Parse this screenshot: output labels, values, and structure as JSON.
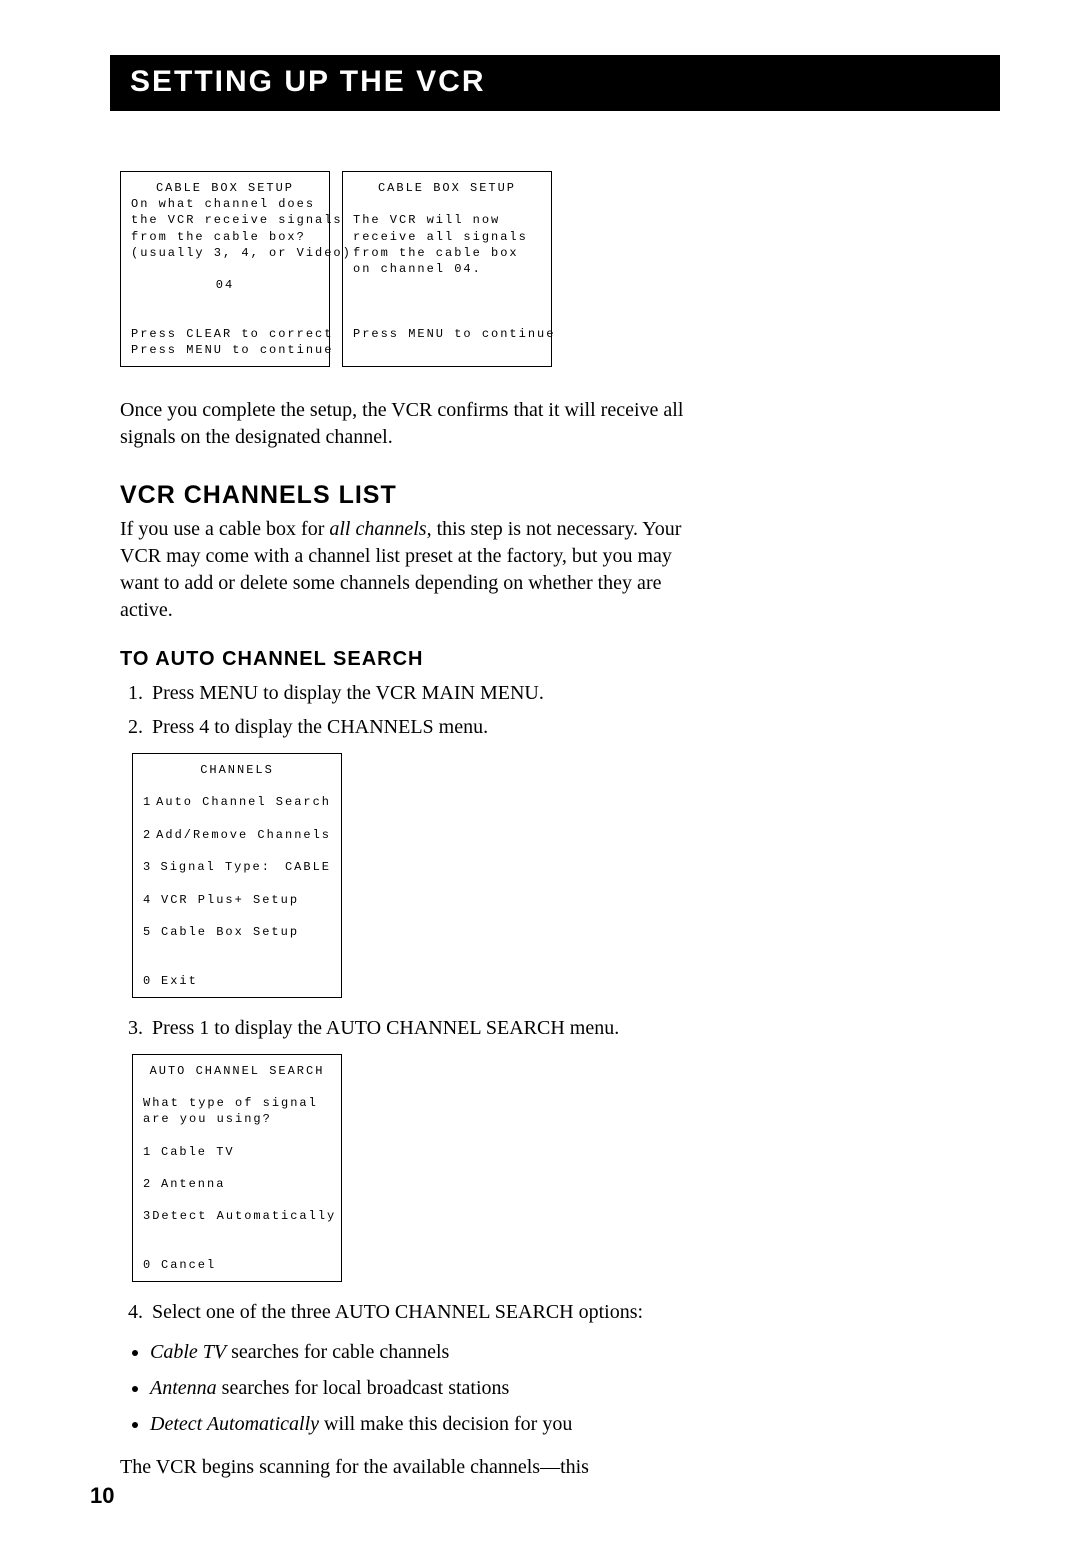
{
  "title": "SETTING UP THE VCR",
  "screen1": {
    "title": "CABLE BOX SETUP",
    "l1": "On what channel does",
    "l2": "the VCR receive signals",
    "l3": "from the cable box?",
    "l4": "(usually 3, 4, or Video)",
    "value": "04",
    "f1": "Press CLEAR to correct",
    "f2": "Press MENU to continue"
  },
  "screen2": {
    "title": "CABLE BOX SETUP",
    "l1": "The VCR will now",
    "l2": "receive all signals",
    "l3": "from the cable box",
    "l4": "on channel 04.",
    "f1": "Press MENU to continue"
  },
  "para1": "Once you complete the setup, the VCR confirms that it will receive all signals on the designated channel.",
  "h2": "VCR CHANNELS LIST",
  "para2a": "If you use a cable box for ",
  "para2i": "all channels",
  "para2b": ", this step is not necessary. Your VCR may come with a channel list preset at the factory, but you may want to add or delete some channels depending on whether they are active.",
  "h3": "TO AUTO CHANNEL SEARCH",
  "steps12": {
    "s1": "Press MENU to display the VCR MAIN MENU.",
    "s2": "Press 4 to display the CHANNELS menu."
  },
  "screen3": {
    "title": "CHANNELS",
    "m1n": "1",
    "m1": "Auto Channel Search",
    "m2n": "2",
    "m2": "Add/Remove Channels",
    "m3n": "3",
    "m3": "Signal Type:",
    "m3v": "CABLE",
    "m4n": "4",
    "m4": "VCR Plus+ Setup",
    "m5n": "5",
    "m5": "Cable Box Setup",
    "m0n": "0",
    "m0": "Exit"
  },
  "step3": "Press 1 to display the AUTO CHANNEL SEARCH menu.",
  "screen4": {
    "title": "AUTO CHANNEL SEARCH",
    "q1": "What type of signal",
    "q2": "are you using?",
    "m1n": "1",
    "m1": "Cable TV",
    "m2n": "2",
    "m2": "Antenna",
    "m3n": "3",
    "m3": "Detect Automatically",
    "m0n": "0",
    "m0": "Cancel"
  },
  "step4": "Select one of the three AUTO CHANNEL SEARCH options:",
  "bullets": {
    "b1i": "Cable TV",
    "b1": " searches for cable channels",
    "b2i": "Antenna",
    "b2": " searches for local broadcast stations",
    "b3i": "Detect Automatically",
    "b3": " will make this decision for you"
  },
  "para3": "The VCR begins scanning for the available channels—this",
  "pageNum": "10"
}
